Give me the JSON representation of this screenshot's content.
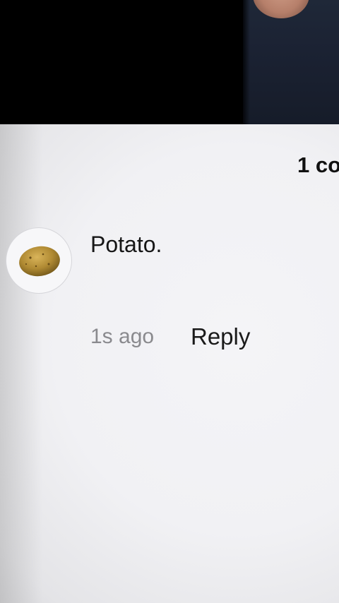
{
  "comments_panel": {
    "count_label": "1 co"
  },
  "comment": {
    "text": "Potato.",
    "timestamp": "1s ago",
    "reply_label": "Reply",
    "avatar_icon": "potato-avatar-icon"
  }
}
